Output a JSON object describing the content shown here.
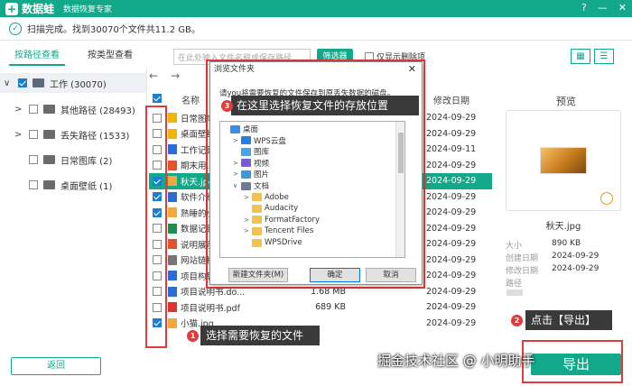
{
  "app": {
    "logo_mark": "+",
    "name": "数据蛙",
    "subtitle": "数据恢复专家",
    "controls": {
      "help": "?",
      "minimize": "—",
      "close": "✕"
    },
    "accent": "#12a88a"
  },
  "status": {
    "check": "✓",
    "text": "扫描完成。找到30070个文件共11.2 GB。"
  },
  "tabs": {
    "by_path": "按路径查看",
    "by_type": "按类型查看"
  },
  "search": {
    "placeholder": "在此处输入文件名称或保存路径"
  },
  "filter_button": "筛选器",
  "only_deleted": "仅显示删除项",
  "nav": {
    "back": "←",
    "forward": "→"
  },
  "sidebar": {
    "root": {
      "label": "工作 (30070)"
    },
    "items": [
      {
        "label": "其他路径 (28493)",
        "arrow": ">"
      },
      {
        "label": "丢失路径 (1533)",
        "arrow": ">"
      },
      {
        "label": "日常图库 (2)",
        "arrow": ""
      },
      {
        "label": "桌面壁纸 (1)",
        "arrow": ""
      }
    ],
    "root_arrow": "∨",
    "back_button": "返回"
  },
  "list": {
    "col_name": "名称",
    "col_date": "修改日期",
    "rows": [
      {
        "name": "日常图库",
        "size": "",
        "date": "2024-09-29",
        "checked": false,
        "icon": "folder"
      },
      {
        "name": "桌面壁纸",
        "size": "",
        "date": "2024-09-29",
        "checked": false,
        "icon": "folder"
      },
      {
        "name": "工作记录1",
        "size": "",
        "date": "2024-09-11",
        "checked": false,
        "icon": "doc"
      },
      {
        "name": "期末用.ppt",
        "size": "",
        "date": "2024-09-29",
        "checked": false,
        "icon": "ppt"
      },
      {
        "name": "秋天.jpg",
        "size": "",
        "date": "2024-09-29",
        "checked": true,
        "icon": "img",
        "selected": true
      },
      {
        "name": "软件介绍 -",
        "size": "",
        "date": "2024-09-29",
        "checked": true,
        "icon": "doc"
      },
      {
        "name": "熟睡的小猫",
        "size": "",
        "date": "2024-09-29",
        "checked": true,
        "icon": "img"
      },
      {
        "name": "数据记录表",
        "size": "",
        "date": "2024-09-29",
        "checked": false,
        "icon": "xls"
      },
      {
        "name": "说明展示.p",
        "size": "",
        "date": "2024-09-29",
        "checked": false,
        "icon": "ppt"
      },
      {
        "name": "网站链接.t",
        "size": "",
        "date": "2024-09-29",
        "checked": false,
        "icon": "txt"
      },
      {
        "name": "项目构思.doc",
        "size": "",
        "date": "2024-09-29",
        "checked": false,
        "icon": "doc"
      },
      {
        "name": "项目说明书.do...",
        "size": "1.68 MB",
        "date": "2024-09-29",
        "checked": false,
        "icon": "doc"
      },
      {
        "name": "项目说明书.pdf",
        "size": "689 KB",
        "date": "2024-09-29",
        "checked": false,
        "icon": "pdf"
      },
      {
        "name": "小猫.jpg",
        "size": "",
        "date": "2024-09-29",
        "checked": true,
        "icon": "img"
      }
    ]
  },
  "preview": {
    "label": "预览",
    "filename": "秋天.jpg",
    "size_label": "大小",
    "size": "890 KB",
    "created_label": "创建日期",
    "created": "2024-09-29",
    "modified_label": "修改日期",
    "modified": "2024-09-29",
    "path_label": "路径"
  },
  "export_button": "导出",
  "dialog": {
    "title": "浏览文件夹",
    "close": "✕",
    "prompt": "请you将需要恢复的文件保存到原丢失数据的磁盘。",
    "tree": [
      {
        "label": "桌面",
        "indent": 0,
        "icon": "desktop",
        "arrow": ""
      },
      {
        "label": "WPS云盘",
        "indent": 1,
        "icon": "cloud",
        "arrow": ">"
      },
      {
        "label": "图库",
        "indent": 1,
        "icon": "gallery",
        "arrow": ""
      },
      {
        "label": "视频",
        "indent": 1,
        "icon": "video",
        "arrow": ">"
      },
      {
        "label": "图片",
        "indent": 1,
        "icon": "picture",
        "arrow": ">"
      },
      {
        "label": "文档",
        "indent": 1,
        "icon": "docs",
        "arrow": "∨"
      },
      {
        "label": "Adobe",
        "indent": 2,
        "icon": "folder",
        "arrow": ">"
      },
      {
        "label": "Audacity",
        "indent": 2,
        "icon": "folder",
        "arrow": ""
      },
      {
        "label": "FormatFactory",
        "indent": 2,
        "icon": "folder",
        "arrow": ">"
      },
      {
        "label": "Tencent Files",
        "indent": 2,
        "icon": "folder",
        "arrow": ">"
      },
      {
        "label": "WPSDrive",
        "indent": 2,
        "icon": "folder",
        "arrow": ""
      }
    ],
    "new_folder": "新建文件夹(M)",
    "ok": "确定",
    "cancel": "取消"
  },
  "annotations": {
    "step1": {
      "num": "1",
      "text": "选择需要恢复的文件"
    },
    "step2": {
      "num": "2",
      "text": "点击【导出】"
    },
    "step3": {
      "num": "3",
      "text": "在这里选择恢复文件的存放位置"
    },
    "watermark": "掘金技术社区 @ 小明助手",
    "color": "#e23b3b"
  }
}
